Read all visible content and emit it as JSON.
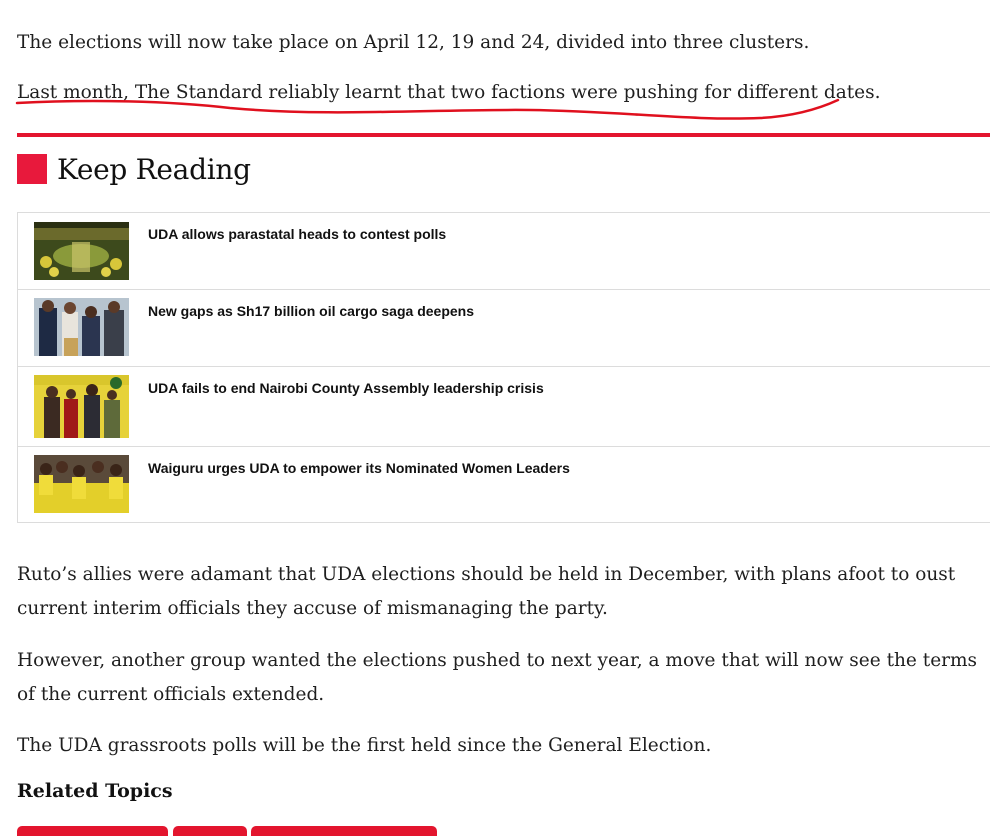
{
  "article": {
    "paragraphs_top": [
      "The elections will now take place on April 12, 19 and 24, divided into three clusters.",
      "Last month, The Standard reliably learnt that two factions were pushing for different dates."
    ],
    "paragraphs_bottom": [
      "Ruto’s allies were adamant that UDA elections should be held in December, with plans afoot to oust current interim officials they accuse of mismanaging the party.",
      "However, another group wanted the elections pushed to next year, a move that will now see the terms of the current officials extended.",
      "The UDA grassroots polls will be the first held since the General Election."
    ]
  },
  "keep_reading": {
    "title": "Keep Reading",
    "items": [
      {
        "title": "UDA allows parastatal heads to contest polls"
      },
      {
        "title": "New gaps as Sh17 billion oil cargo saga deepens"
      },
      {
        "title": "UDA fails to end Nairobi County Assembly leadership crisis"
      },
      {
        "title": "Waiguru urges UDA to empower its Nominated Women Leaders"
      }
    ]
  },
  "related_topics": {
    "title": "Related Topics"
  },
  "colors": {
    "accent": "#e3152e",
    "annotation": "#e0101e"
  }
}
